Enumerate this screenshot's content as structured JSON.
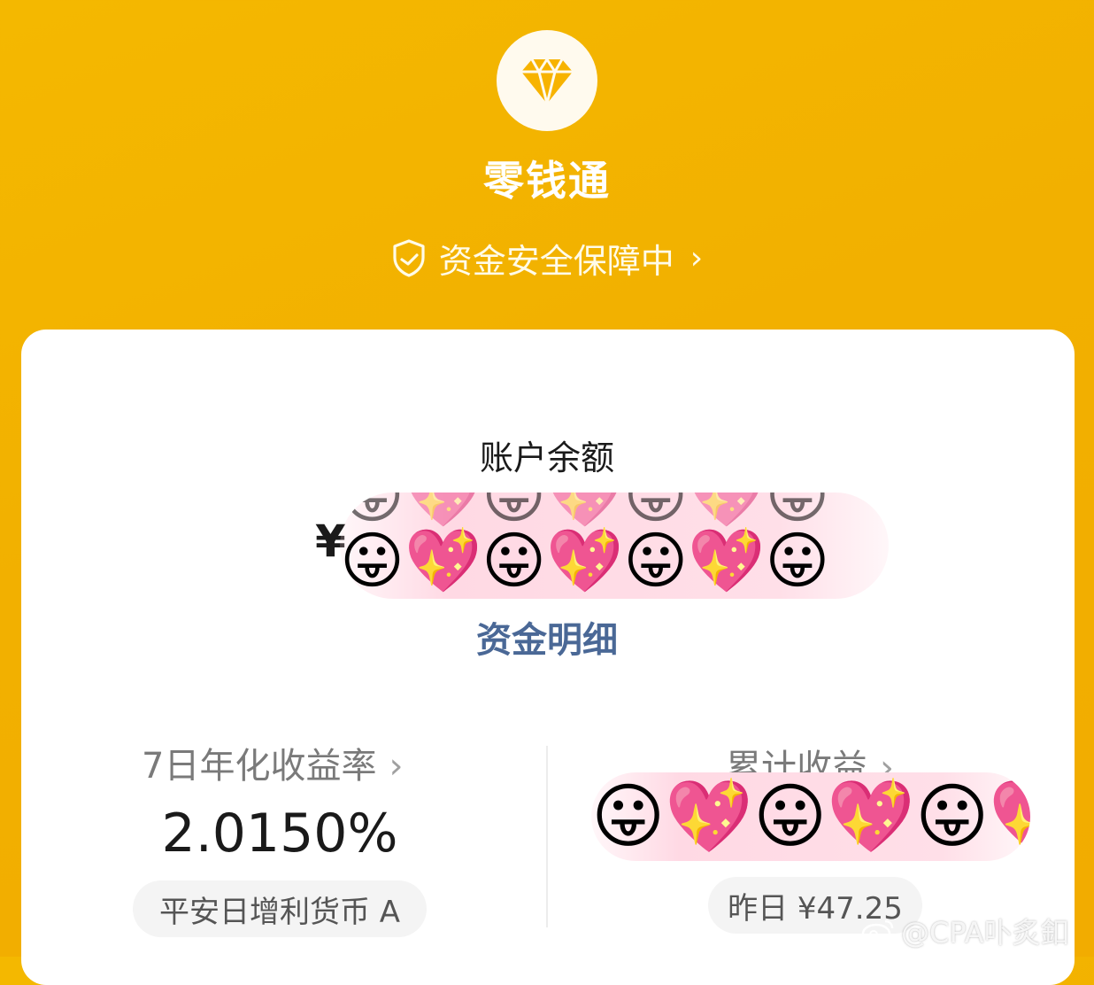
{
  "header": {
    "logo_icon": "diamond-icon",
    "title": "零钱通",
    "safety_text": "资金安全保障中",
    "safety_icon": "shield-check-icon",
    "chevron_icon": "chevron-right-icon",
    "bg_color": "#F2B000"
  },
  "balance": {
    "label": "账户余额",
    "currency": "¥",
    "amount_obscured_emoji": "😛💖😛💖😛💖😛",
    "detail_link": "资金明细"
  },
  "stats": {
    "rate_label": "7日年化收益率",
    "rate_value": "2.0150%",
    "fund_name": "平安日增利货币 A",
    "cumulative_label": "累计收益",
    "cumulative_obscured_emoji": "😛💖😛💖😛💖",
    "yesterday_label": "昨日 ¥47.25"
  },
  "watermark": {
    "text": "@CPA卟炙釦",
    "icon": "weibo-icon"
  },
  "colors": {
    "accent": "#F2B000",
    "link": "#4A6896",
    "card": "#FFFFFF"
  }
}
